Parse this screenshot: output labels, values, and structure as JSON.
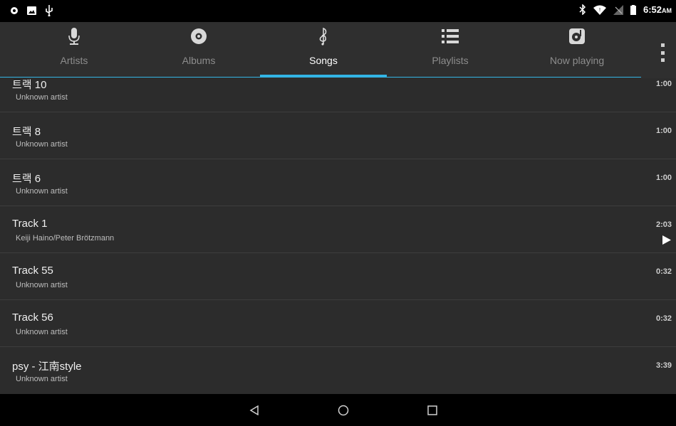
{
  "status_bar": {
    "time": "6:52",
    "ampm": "AM",
    "left_icons": [
      "notification-icon",
      "image-icon",
      "usb-icon"
    ],
    "right_icons": [
      "bluetooth-icon",
      "wifi-icon",
      "signal-icon",
      "battery-icon"
    ]
  },
  "tabs": [
    {
      "label": "Artists",
      "icon": "microphone-icon",
      "active": false
    },
    {
      "label": "Albums",
      "icon": "disc-icon",
      "active": false
    },
    {
      "label": "Songs",
      "icon": "music-note-icon",
      "active": true
    },
    {
      "label": "Playlists",
      "icon": "playlist-icon",
      "active": false
    },
    {
      "label": "Now playing",
      "icon": "now-playing-icon",
      "active": false
    }
  ],
  "accent_color": "#33b5e5",
  "songs": [
    {
      "title": "트랙 10",
      "artist": "Unknown artist",
      "duration": "1:00",
      "playing": false
    },
    {
      "title": "트랙 8",
      "artist": "Unknown artist",
      "duration": "1:00",
      "playing": false
    },
    {
      "title": "트랙 6",
      "artist": "Unknown artist",
      "duration": "1:00",
      "playing": false
    },
    {
      "title": "Track 1",
      "artist": "Keiji Haino/Peter Brötzmann",
      "duration": "2:03",
      "playing": true
    },
    {
      "title": "Track 55",
      "artist": "Unknown artist",
      "duration": "0:32",
      "playing": false
    },
    {
      "title": "Track 56",
      "artist": "Unknown artist",
      "duration": "0:32",
      "playing": false
    },
    {
      "title": "psy - 江南style",
      "artist": "Unknown artist",
      "duration": "3:39",
      "playing": false
    }
  ],
  "nav": [
    "back-icon",
    "home-icon",
    "recents-icon"
  ]
}
